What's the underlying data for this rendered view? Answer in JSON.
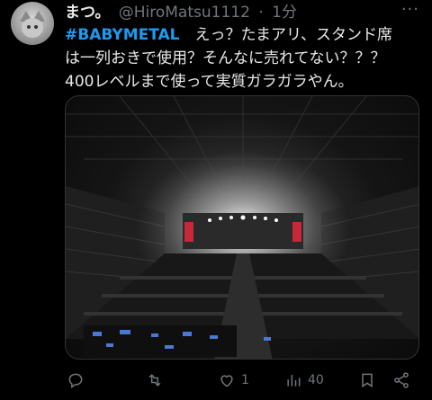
{
  "tweet": {
    "display_name": "まつ。",
    "handle": "@HiroMatsu1112",
    "separator": "·",
    "time": "1分",
    "more_icon": "ellipsis-icon",
    "hashtag": "#BABYMETAL",
    "line1_rest": "　えっ？たまアリ、スタンド席",
    "line2": "は一列おきで使用？そんなに売れてない？？？",
    "line3": "400レベルまで使って実質ガラガラやん。"
  },
  "actions": {
    "reply_icon": "reply-icon",
    "retweet_icon": "retweet-icon",
    "like_icon": "heart-icon",
    "like_count": "1",
    "views_icon": "views-chart-icon",
    "views_count": "40",
    "bookmark_icon": "bookmark-icon",
    "share_icon": "share-icon"
  },
  "colors": {
    "background": "#000000",
    "text": "#e7e9ea",
    "muted": "#71767b",
    "hashtag": "#1d9bf0"
  }
}
